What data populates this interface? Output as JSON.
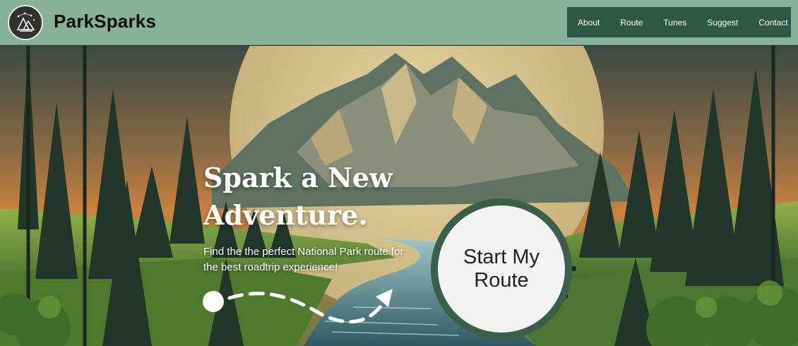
{
  "header": {
    "brand": "ParkSparks",
    "logo_icon": "mountain-constellation-logo",
    "nav": [
      {
        "label": "About"
      },
      {
        "label": "Route"
      },
      {
        "label": "Tunes"
      },
      {
        "label": "Suggest"
      },
      {
        "label": "Contact"
      }
    ]
  },
  "hero": {
    "headline": "Spark a New Adventure.",
    "subtext": "Find the the perfect National Park route for the best roadtrip experience!",
    "cta_label": "Start My Route",
    "background": "illustrated-mountain-forest-river",
    "arrow_icon": "dashed-route-arrow-icon"
  },
  "colors": {
    "header_bg": "#87b09a",
    "nav_bg": "#2f5746",
    "cta_ring": "#3b5f4a",
    "cta_fill": "#f3f3f2"
  }
}
